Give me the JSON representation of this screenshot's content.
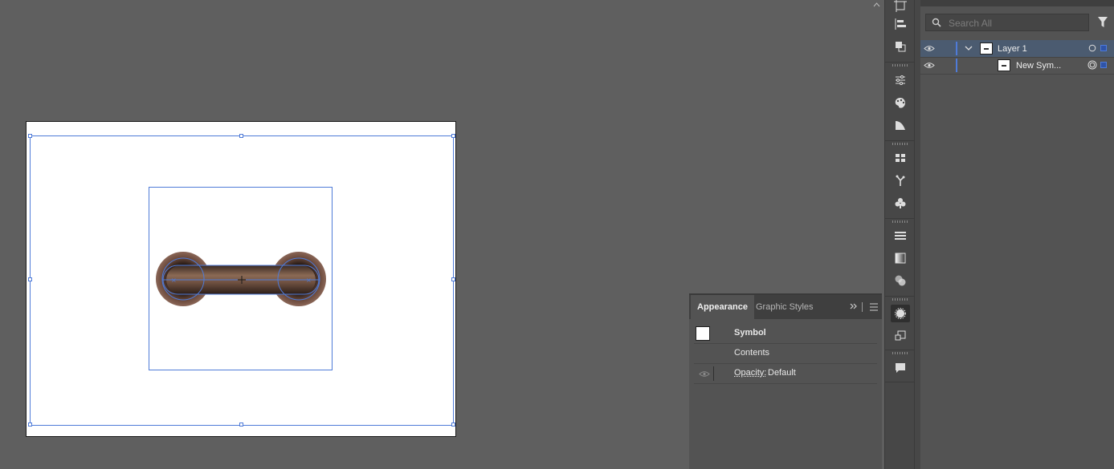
{
  "appearance_panel": {
    "tabs": [
      {
        "label": "Appearance",
        "active": true
      },
      {
        "label": "Graphic Styles",
        "active": false
      }
    ],
    "rows": [
      {
        "label": "Symbol"
      },
      {
        "label": "Contents"
      },
      {
        "label": "Opacity:",
        "value": "Default"
      }
    ]
  },
  "layers_panel": {
    "search_placeholder": "Search All",
    "layers": [
      {
        "name": "Layer 1",
        "expanded": true
      },
      {
        "name": "New Sym..."
      }
    ]
  },
  "colors": {
    "background": "#5f5f5f",
    "panel": "#535353",
    "selection": "#4f7bd8",
    "layer_highlight": "#4b5b70"
  }
}
